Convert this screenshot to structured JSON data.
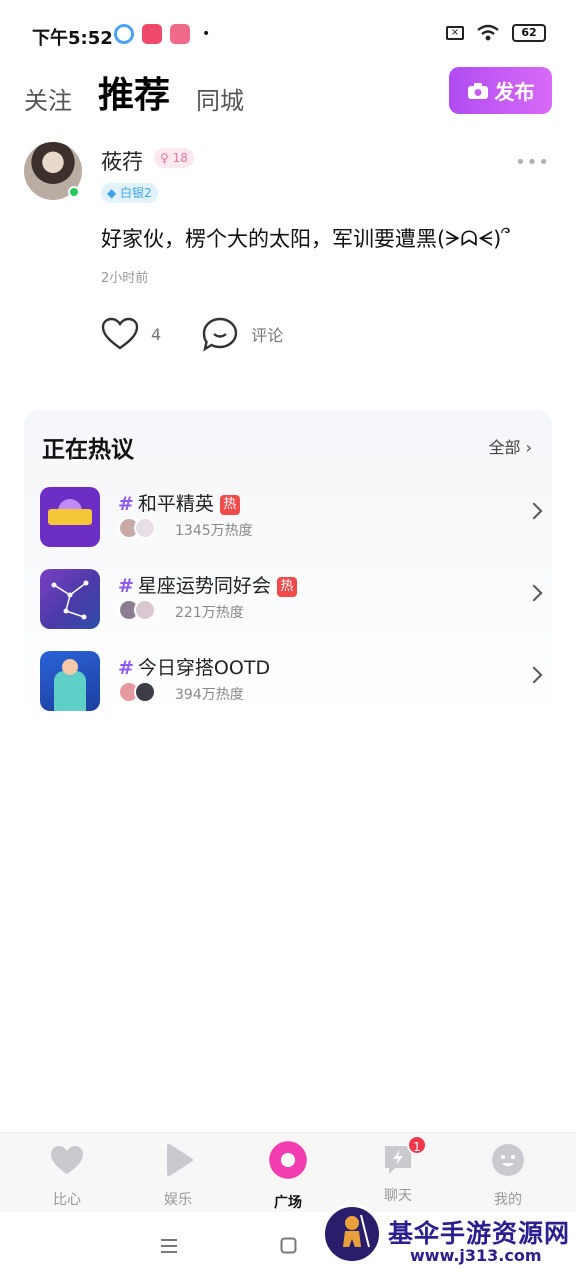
{
  "status_bar": {
    "time": "下午5:52",
    "battery": "62"
  },
  "tabs": [
    {
      "label": "关注"
    },
    {
      "label": "推荐"
    },
    {
      "label": "同城"
    }
  ],
  "publish_label": "发布",
  "post": {
    "username": "莜荇",
    "age": "18",
    "level": "白银2",
    "content": "好家伙，楞个大的太阳，军训要遭黑(ᗒᗣᗕ)՞",
    "time": "2小时前",
    "likes": "4",
    "comment_label": "评论"
  },
  "hot": {
    "title": "正在热议",
    "all_label": "全部",
    "topics": [
      {
        "name": "和平精英",
        "hot": "热",
        "heat": "1345万热度"
      },
      {
        "name": "星座运势同好会",
        "hot": "热",
        "heat": "221万热度"
      },
      {
        "name": "今日穿搭OOTD",
        "heat": "394万热度"
      }
    ]
  },
  "bottom_nav": [
    {
      "label": "比心"
    },
    {
      "label": "娱乐"
    },
    {
      "label": "广场"
    },
    {
      "label": "聊天",
      "badge": "1"
    },
    {
      "label": "我的"
    }
  ],
  "watermark": {
    "line1": "基伞手游资源网",
    "line2": "www.j313.com"
  },
  "colors": {
    "accent": "#b04cf0",
    "active_nav": "#f23eb0",
    "hot": "#f24b4b"
  }
}
